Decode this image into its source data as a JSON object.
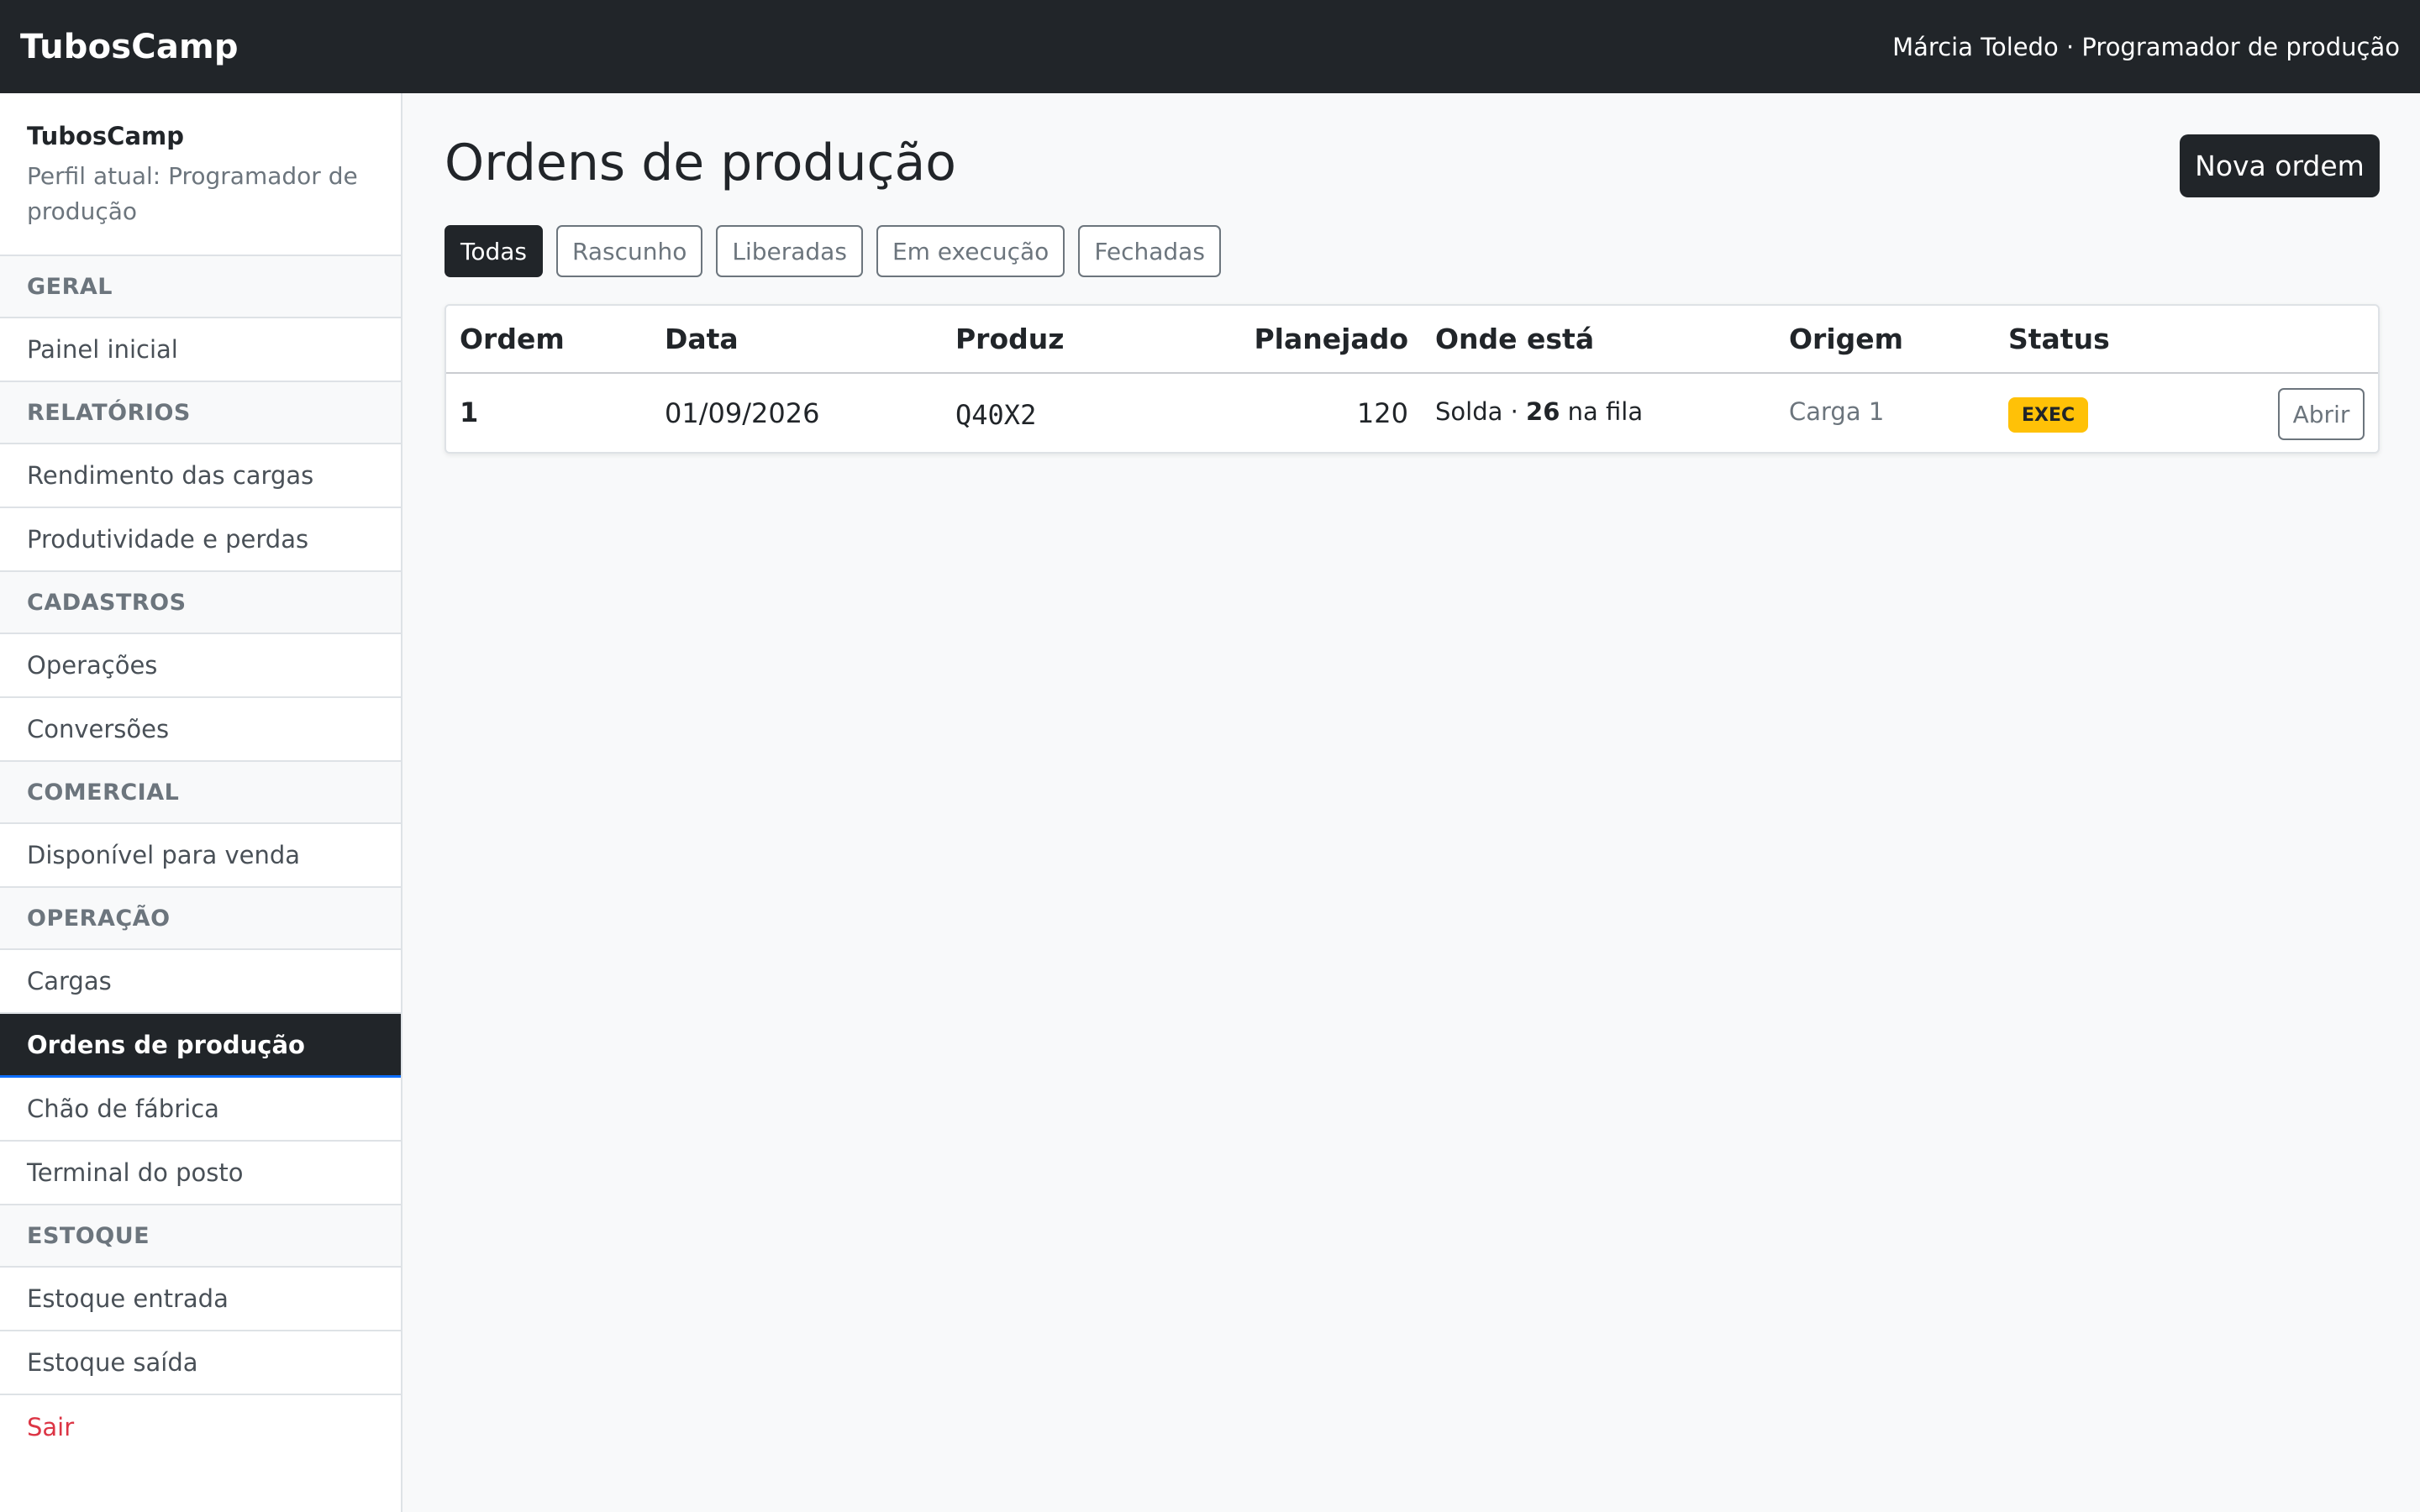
{
  "topbar": {
    "brand": "TubosCamp",
    "user": "Márcia Toledo · Programador de produção"
  },
  "sidebar": {
    "brand": "TubosCamp",
    "profile": "Perfil atual: Programador de produção",
    "sections": [
      {
        "title": "GERAL",
        "items": [
          "Painel inicial"
        ]
      },
      {
        "title": "RELATÓRIOS",
        "items": [
          "Rendimento das cargas",
          "Produtividade e perdas"
        ]
      },
      {
        "title": "CADASTROS",
        "items": [
          "Operações",
          "Conversões"
        ]
      },
      {
        "title": "COMERCIAL",
        "items": [
          "Disponível para venda"
        ]
      },
      {
        "title": "OPERAÇÃO",
        "items": [
          "Cargas",
          "Ordens de produção",
          "Chão de fábrica",
          "Terminal do posto"
        ]
      },
      {
        "title": "ESTOQUE",
        "items": [
          "Estoque entrada",
          "Estoque saída"
        ]
      }
    ],
    "active_item": "Ordens de produção",
    "logout": "Sair"
  },
  "main": {
    "title": "Ordens de produção",
    "new_button": "Nova ordem",
    "filters": [
      "Todas",
      "Rascunho",
      "Liberadas",
      "Em execução",
      "Fechadas"
    ],
    "active_filter": "Todas",
    "table": {
      "headers": [
        "Ordem",
        "Data",
        "Produz",
        "Planejado",
        "Onde está",
        "Origem",
        "Status"
      ],
      "rows": [
        {
          "ordem": "1",
          "data": "01/09/2026",
          "produz": "Q40X2",
          "planejado": "120",
          "onde_posto": "Solda · ",
          "onde_qtd": "26",
          "onde_sufixo": " na fila",
          "origem": "Carga 1",
          "status": "EXEC",
          "action": "Abrir"
        }
      ]
    }
  },
  "colors": {
    "dark": "#212529",
    "muted": "#6c757d",
    "status_exec": "#ffc107",
    "danger": "#dc3545",
    "active_underline": "#0d6efd"
  }
}
